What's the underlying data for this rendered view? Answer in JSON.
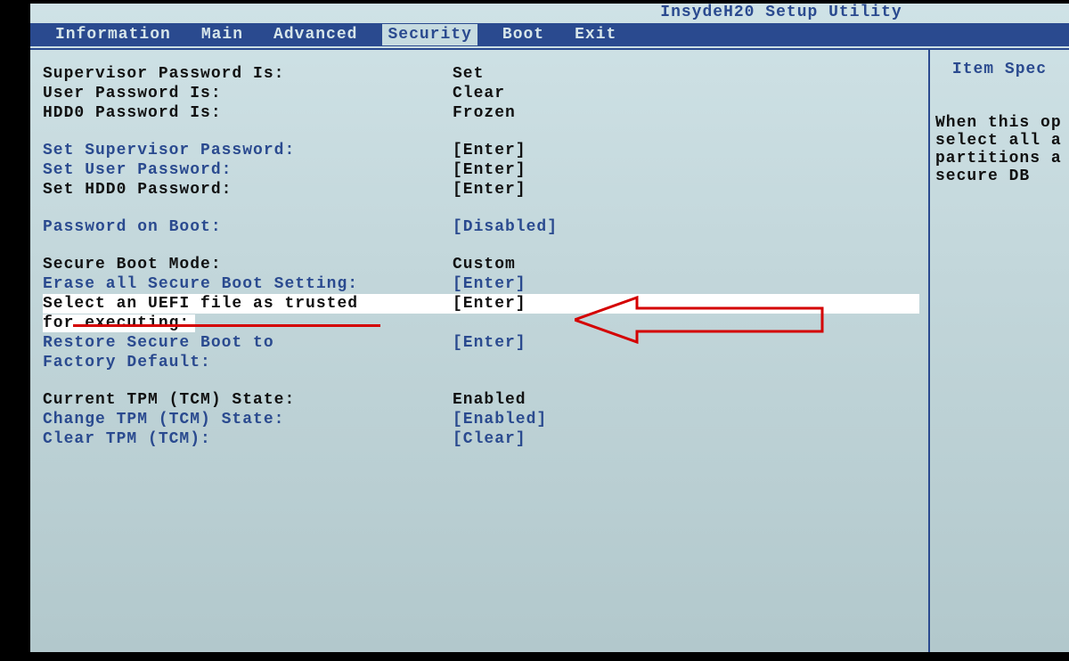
{
  "title": "InsydeH20 Setup Utility",
  "tabs": {
    "information": "Information",
    "main": "Main",
    "advanced": "Advanced",
    "security": "Security",
    "boot": "Boot",
    "exit": "Exit"
  },
  "rows": {
    "supPwdLabel": "Supervisor Password Is:",
    "supPwdValue": "Set",
    "usrPwdLabel": "User Password Is:",
    "usrPwdValue": "Clear",
    "hddPwdLabel": "HDD0 Password Is:",
    "hddPwdValue": "Frozen",
    "setSupLabel": "Set Supervisor Password:",
    "setSupValue": "[Enter]",
    "setUsrLabel": "Set User Password:",
    "setUsrValue": "[Enter]",
    "setHddLabel": "Set HDD0 Password:",
    "setHddValue": "[Enter]",
    "pwdBootLabel": "Password on Boot:",
    "pwdBootValue": "[Disabled]",
    "secModeLabel": "Secure Boot Mode:",
    "secModeValue": "Custom",
    "eraseLabel": "Erase all Secure Boot Setting:",
    "eraseValue": "[Enter]",
    "selUefiLabel1": "Select an UEFI file as trusted",
    "selUefiValue": "[Enter]",
    "selUefiLabel2": "for executing:",
    "restoreLabel1": "Restore Secure Boot to",
    "restoreValue": "[Enter]",
    "restoreLabel2": "Factory Default:",
    "tpmStateLabel": "Current TPM (TCM) State:",
    "tpmStateValue": "Enabled",
    "chgTpmLabel": "Change TPM (TCM) State:",
    "chgTpmValue": "[Enabled]",
    "clrTpmLabel": "Clear TPM (TCM):",
    "clrTpmValue": "[Clear]"
  },
  "help": {
    "title": "Item Spec",
    "line1": "When this op",
    "line2": "select all a",
    "line3": "partitions a",
    "line4": "secure DB"
  }
}
